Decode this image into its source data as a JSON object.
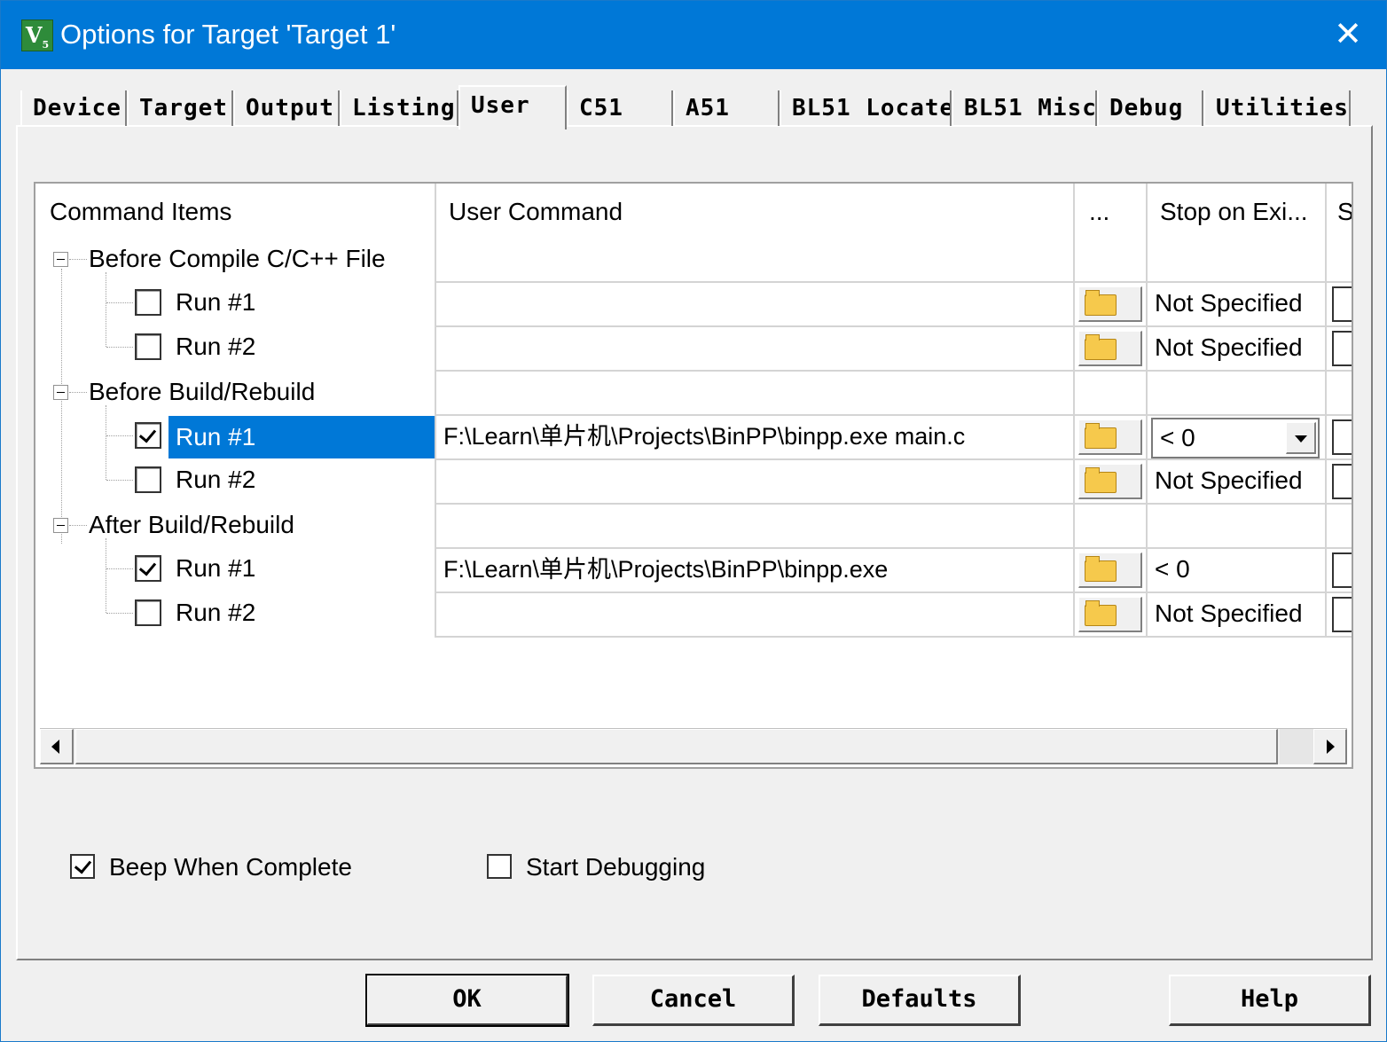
{
  "window": {
    "title": "Options for Target 'Target 1'",
    "close_symbol": "✕",
    "app_icon_letter": "V",
    "app_icon_sub": "5"
  },
  "tabs": [
    "Device",
    "Target",
    "Output",
    "Listing",
    "User",
    "C51",
    "A51",
    "BL51 Locate",
    "BL51 Misc",
    "Debug",
    "Utilities"
  ],
  "active_tab": "User",
  "grid": {
    "headers": {
      "items": "Command Items",
      "command": "User Command",
      "browse": "...",
      "stop": "Stop on Exi...",
      "extra": "S"
    },
    "groups": [
      {
        "label": "Before Compile C/C++ File",
        "runs": [
          {
            "label": "Run #1",
            "checked": false,
            "command": "",
            "stop": "Not Specified"
          },
          {
            "label": "Run #2",
            "checked": false,
            "command": "",
            "stop": "Not Specified"
          }
        ]
      },
      {
        "label": "Before Build/Rebuild",
        "runs": [
          {
            "label": "Run #1",
            "checked": true,
            "selected": true,
            "command": "F:\\Learn\\单片机\\Projects\\BinPP\\binpp.exe main.c",
            "stop": "< 0"
          },
          {
            "label": "Run #2",
            "checked": false,
            "command": "",
            "stop": "Not Specified"
          }
        ]
      },
      {
        "label": "After Build/Rebuild",
        "runs": [
          {
            "label": "Run #1",
            "checked": true,
            "command": "F:\\Learn\\单片机\\Projects\\BinPP\\binpp.exe",
            "stop": "< 0"
          },
          {
            "label": "Run #2",
            "checked": false,
            "command": "",
            "stop": "Not Specified"
          }
        ]
      }
    ]
  },
  "options": {
    "beep": {
      "label": "Beep When Complete",
      "checked": true
    },
    "debug": {
      "label": "Start Debugging",
      "checked": false
    }
  },
  "buttons": {
    "ok": "OK",
    "cancel": "Cancel",
    "defaults": "Defaults",
    "help": "Help"
  },
  "colors": {
    "title_bar": "#0078d7",
    "selection": "#0078d7"
  }
}
